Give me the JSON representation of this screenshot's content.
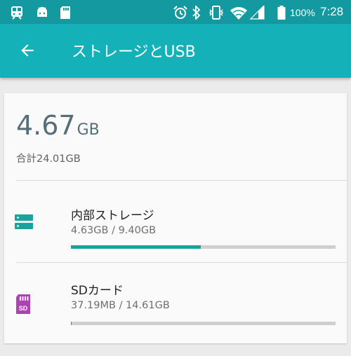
{
  "status_bar": {
    "battery_percent": "100%",
    "time": "7:28",
    "icons": [
      "train-icon",
      "android-icon",
      "sd-card-icon",
      "alarm-icon",
      "bluetooth-icon",
      "vibrate-icon",
      "wifi-icon",
      "signal-icon",
      "battery-icon"
    ],
    "bg_color": "#139aa0"
  },
  "app_bar": {
    "back_icon": "arrow-left-icon",
    "title": "ストレージとUSB",
    "bg_color": "#15b1b8"
  },
  "summary": {
    "used_value": "4.67",
    "used_unit": "GB",
    "total": "合計24.01GB"
  },
  "storage_items": [
    {
      "name": "内部ストレージ",
      "detail": "4.63GB / 9.40GB",
      "icon": "internal-storage-icon",
      "usage_fraction": 0.49,
      "bar_color": "#1aa39c"
    },
    {
      "name": "SDカード",
      "detail": "37.19MB / 14.61GB",
      "icon": "sd-card-icon",
      "usage_fraction": 0.0025,
      "bar_color": "#1aa39c"
    }
  ]
}
